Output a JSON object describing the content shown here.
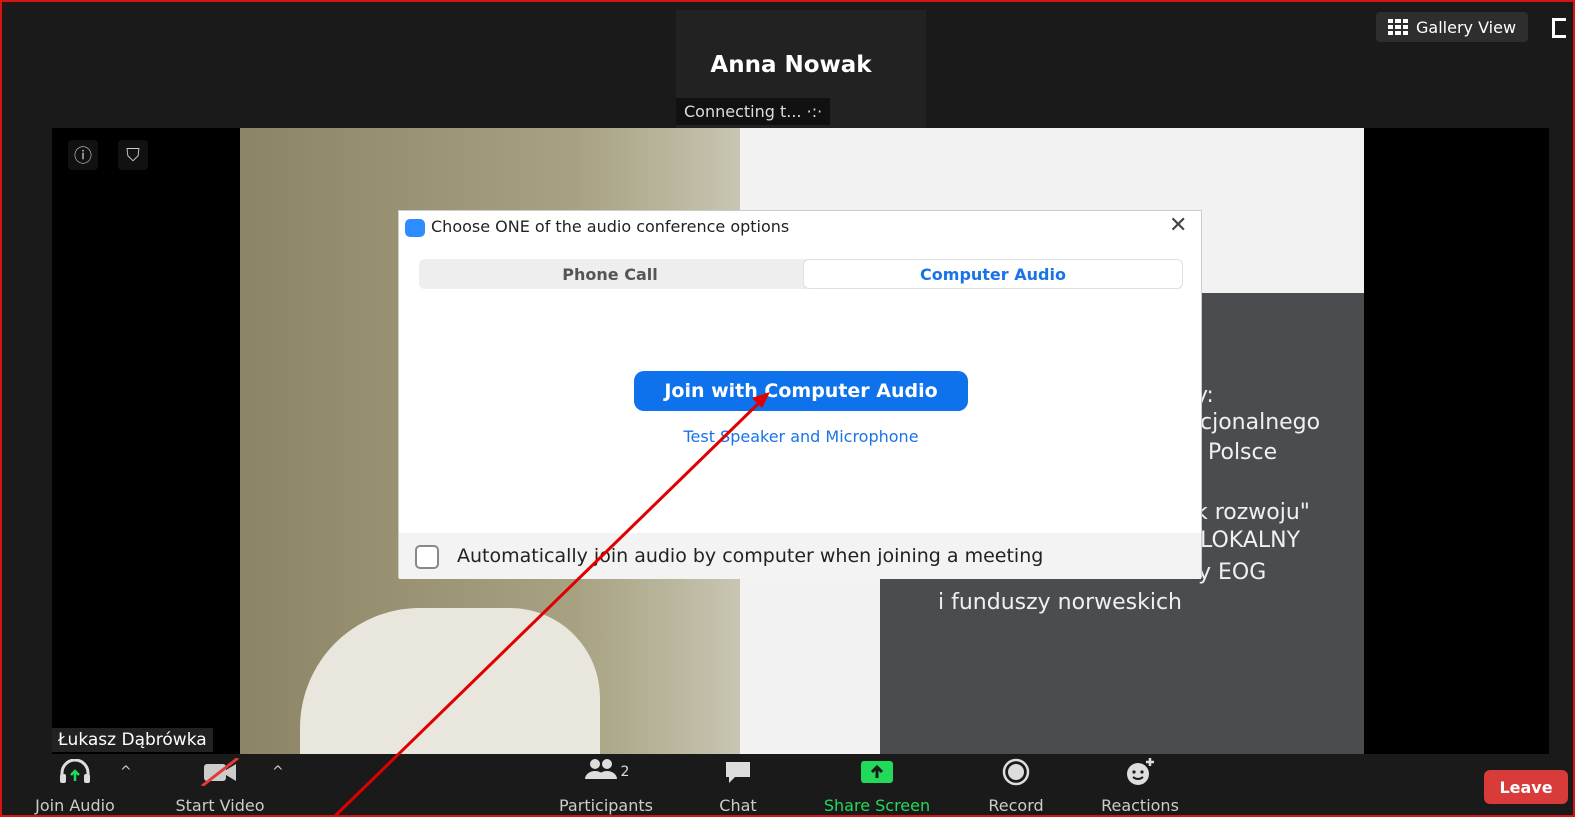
{
  "header": {
    "speaker_name": "Anna Nowak",
    "status": "Connecting t...",
    "gallery_view": "Gallery View"
  },
  "video": {
    "participant_name": "Łukasz Dąbrówka",
    "poster_lines": [
      "y:",
      "cjonalnego",
      "Polsce",
      "k rozwoju\"",
      "LOKALNY",
      "y EOG",
      "i funduszy norweskich"
    ]
  },
  "dialog": {
    "title": "Choose ONE of the audio conference options",
    "tabs": [
      {
        "label": "Phone Call",
        "selected": false
      },
      {
        "label": "Computer Audio",
        "selected": true
      }
    ],
    "join_button": "Join with Computer Audio",
    "test_link": "Test Speaker and Microphone",
    "auto_join_label": "Automatically join audio by computer when joining a meeting",
    "auto_join_checked": false
  },
  "toolbar": {
    "join_audio": "Join Audio",
    "start_video": "Start Video",
    "participants": "Participants",
    "participant_count": "2",
    "chat": "Chat",
    "share_screen": "Share Screen",
    "record": "Record",
    "reactions": "Reactions",
    "leave": "Leave"
  },
  "colors": {
    "accent": "#0e72ed",
    "share_green": "#23d959",
    "leave_red": "#d93a3a",
    "annotation_red": "#e00000"
  }
}
